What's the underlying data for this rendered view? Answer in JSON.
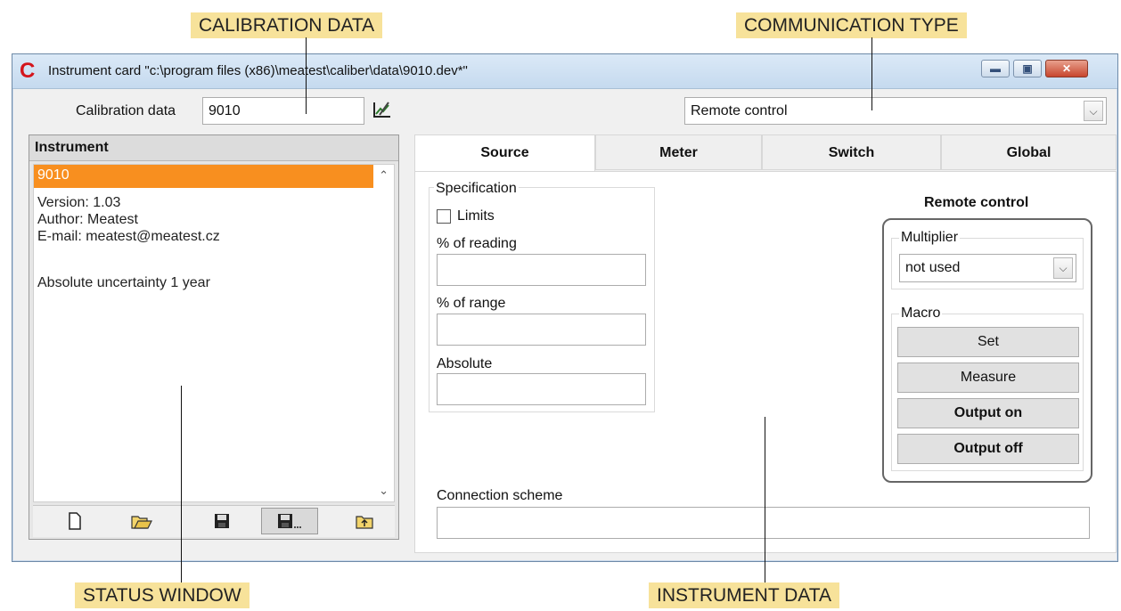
{
  "annotations": {
    "calibration_data": "CALIBRATION DATA",
    "communication_type": "COMMUNICATION TYPE",
    "status_window": "STATUS WINDOW",
    "instrument_data": "INSTRUMENT DATA"
  },
  "window": {
    "title": "Instrument card \"c:\\program files (x86)\\meatest\\caliber\\data\\9010.dev*\"",
    "icon": "C"
  },
  "calibration": {
    "label": "Calibration data",
    "value": "9010",
    "edit_icon": "edit-chart-icon"
  },
  "communication": {
    "selected": "Remote control"
  },
  "instrument_panel": {
    "header": "Instrument",
    "selected_item": "9010",
    "lines": [
      "Version: 1.03",
      "Author:  Meatest",
      "E-mail:  meatest@meatest.cz",
      "",
      "Absolute uncertainty 1 year"
    ],
    "toolbar": [
      "new-file-icon",
      "open-folder-icon",
      "save-icon",
      "save-as-icon",
      "export-icon"
    ]
  },
  "tabs": [
    "Source",
    "Meter",
    "Switch",
    "Global"
  ],
  "active_tab": "Source",
  "specification": {
    "title": "Specification",
    "limits_label": "Limits",
    "limits_checked": false,
    "pct_reading_label": "% of reading",
    "pct_reading_value": "",
    "pct_range_label": "% of range",
    "pct_range_value": "",
    "absolute_label": "Absolute",
    "absolute_value": ""
  },
  "remote_control": {
    "title": "Remote control",
    "multiplier_title": "Multiplier",
    "multiplier_value": "not used",
    "macro_title": "Macro",
    "macro_buttons": [
      "Set",
      "Measure",
      "Output on",
      "Output off"
    ]
  },
  "connection": {
    "label": "Connection scheme",
    "value": ""
  },
  "colors": {
    "selection": "#f88f1f",
    "callout_bg": "#f7e29a",
    "close_button": "#c7462e"
  }
}
